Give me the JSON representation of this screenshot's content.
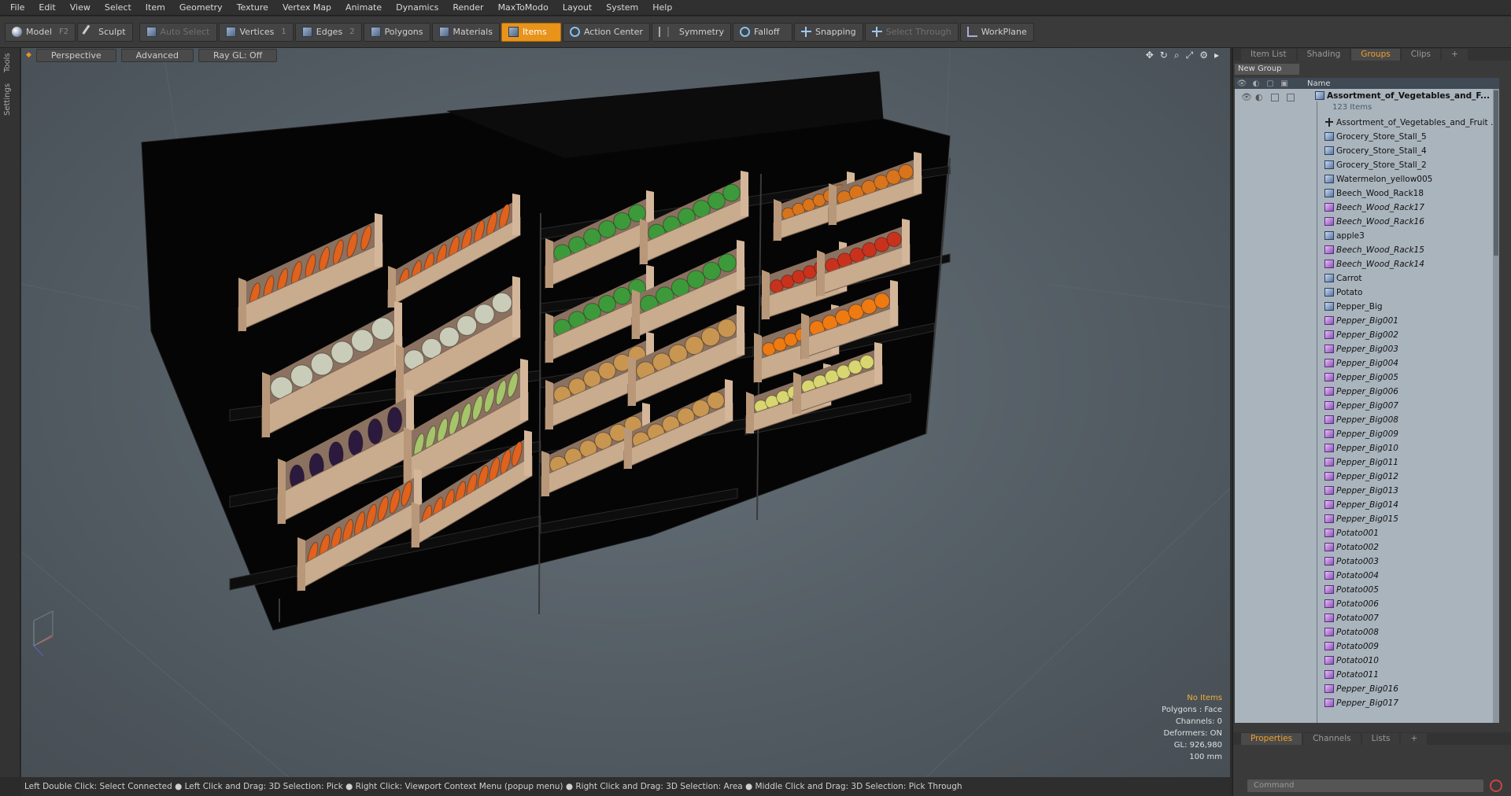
{
  "menu": [
    "File",
    "Edit",
    "View",
    "Select",
    "Item",
    "Geometry",
    "Texture",
    "Vertex Map",
    "Animate",
    "Dynamics",
    "Render",
    "MaxToModo",
    "Layout",
    "System",
    "Help"
  ],
  "toolbar": {
    "model": "Model",
    "model_key": "F2",
    "sculpt": "Sculpt",
    "auto_select": "Auto Select",
    "vertices": "Vertices",
    "vertices_key": "1",
    "edges": "Edges",
    "edges_key": "2",
    "polygons": "Polygons",
    "materials": "Materials",
    "items": "Items",
    "action_center": "Action Center",
    "symmetry": "Symmetry",
    "falloff": "Falloff",
    "snapping": "Snapping",
    "select_through": "Select Through",
    "workplane": "WorkPlane"
  },
  "left_tabs": [
    "Tools",
    "Settings"
  ],
  "viewport": {
    "perspective": "Perspective",
    "advanced": "Advanced",
    "raygl": "Ray GL: Off",
    "info_items": "No Items",
    "info_polys": "Polygons : Face",
    "info_channels": "Channels: 0",
    "info_deformers": "Deformers: ON",
    "info_gl": "GL: 926,980",
    "info_scale": "100 mm"
  },
  "status": "Left Double Click: Select Connected ● Left Click and Drag: 3D Selection: Pick ● Right Click: Viewport Context Menu (popup menu) ● Right Click and Drag: 3D Selection: Area ● Middle Click and Drag: 3D Selection: Pick Through",
  "panel": {
    "tabs": [
      "Item List",
      "Shading",
      "Groups",
      "Clips",
      "+"
    ],
    "active_tab": "Groups",
    "new_group": "New Group",
    "col_name": "Name",
    "root_name": "Assortment_of_Vegetables_and_F...",
    "root_count": "123 Items",
    "items": [
      {
        "name": "Assortment_of_Vegetables_and_Fruit ...",
        "kind": "loc",
        "italic": false
      },
      {
        "name": "Grocery_Store_Stall_5",
        "kind": "mesh",
        "italic": false
      },
      {
        "name": "Grocery_Store_Stall_4",
        "kind": "mesh",
        "italic": false
      },
      {
        "name": "Grocery_Store_Stall_2",
        "kind": "mesh",
        "italic": false
      },
      {
        "name": "Watermelon_yellow005",
        "kind": "mesh",
        "italic": false
      },
      {
        "name": "Beech_Wood_Rack18",
        "kind": "mesh",
        "italic": false
      },
      {
        "name": "Beech_Wood_Rack17",
        "kind": "inst",
        "italic": true
      },
      {
        "name": "Beech_Wood_Rack16",
        "kind": "inst",
        "italic": true
      },
      {
        "name": "apple3",
        "kind": "mesh",
        "italic": false
      },
      {
        "name": "Beech_Wood_Rack15",
        "kind": "inst",
        "italic": true
      },
      {
        "name": "Beech_Wood_Rack14",
        "kind": "inst",
        "italic": true
      },
      {
        "name": "Carrot",
        "kind": "mesh",
        "italic": false
      },
      {
        "name": "Potato",
        "kind": "mesh",
        "italic": false
      },
      {
        "name": "Pepper_Big",
        "kind": "mesh",
        "italic": false
      },
      {
        "name": "Pepper_Big001",
        "kind": "inst",
        "italic": true
      },
      {
        "name": "Pepper_Big002",
        "kind": "inst",
        "italic": true
      },
      {
        "name": "Pepper_Big003",
        "kind": "inst",
        "italic": true
      },
      {
        "name": "Pepper_Big004",
        "kind": "inst",
        "italic": true
      },
      {
        "name": "Pepper_Big005",
        "kind": "inst",
        "italic": true
      },
      {
        "name": "Pepper_Big006",
        "kind": "inst",
        "italic": true
      },
      {
        "name": "Pepper_Big007",
        "kind": "inst",
        "italic": true
      },
      {
        "name": "Pepper_Big008",
        "kind": "inst",
        "italic": true
      },
      {
        "name": "Pepper_Big009",
        "kind": "inst",
        "italic": true
      },
      {
        "name": "Pepper_Big010",
        "kind": "inst",
        "italic": true
      },
      {
        "name": "Pepper_Big011",
        "kind": "inst",
        "italic": true
      },
      {
        "name": "Pepper_Big012",
        "kind": "inst",
        "italic": true
      },
      {
        "name": "Pepper_Big013",
        "kind": "inst",
        "italic": true
      },
      {
        "name": "Pepper_Big014",
        "kind": "inst",
        "italic": true
      },
      {
        "name": "Pepper_Big015",
        "kind": "inst",
        "italic": true
      },
      {
        "name": "Potato001",
        "kind": "inst",
        "italic": true
      },
      {
        "name": "Potato002",
        "kind": "inst",
        "italic": true
      },
      {
        "name": "Potato003",
        "kind": "inst",
        "italic": true
      },
      {
        "name": "Potato004",
        "kind": "inst",
        "italic": true
      },
      {
        "name": "Potato005",
        "kind": "inst",
        "italic": true
      },
      {
        "name": "Potato006",
        "kind": "inst",
        "italic": true
      },
      {
        "name": "Potato007",
        "kind": "inst",
        "italic": true
      },
      {
        "name": "Potato008",
        "kind": "inst",
        "italic": true
      },
      {
        "name": "Potato009",
        "kind": "inst",
        "italic": true
      },
      {
        "name": "Potato010",
        "kind": "inst",
        "italic": true
      },
      {
        "name": "Potato011",
        "kind": "inst",
        "italic": true
      },
      {
        "name": "Pepper_Big016",
        "kind": "inst",
        "italic": true
      },
      {
        "name": "Pepper_Big017",
        "kind": "inst",
        "italic": true
      }
    ],
    "bottom_tabs": [
      "Properties",
      "Channels",
      "Lists",
      "+"
    ],
    "command_placeholder": "Command"
  },
  "colors": {
    "accent": "#e8941a",
    "carrot": "#e0621c",
    "pepper": "#3d9a3a",
    "cauliflower": "#c9ccb8",
    "zucchini": "#a6c46a",
    "eggplant": "#2c1a3e",
    "potato": "#c89650",
    "pumpkin": "#d8741c",
    "tomato": "#c8321c",
    "orange": "#ee7a12",
    "melon": "#d8d670",
    "crate": "#c9ab8e"
  }
}
